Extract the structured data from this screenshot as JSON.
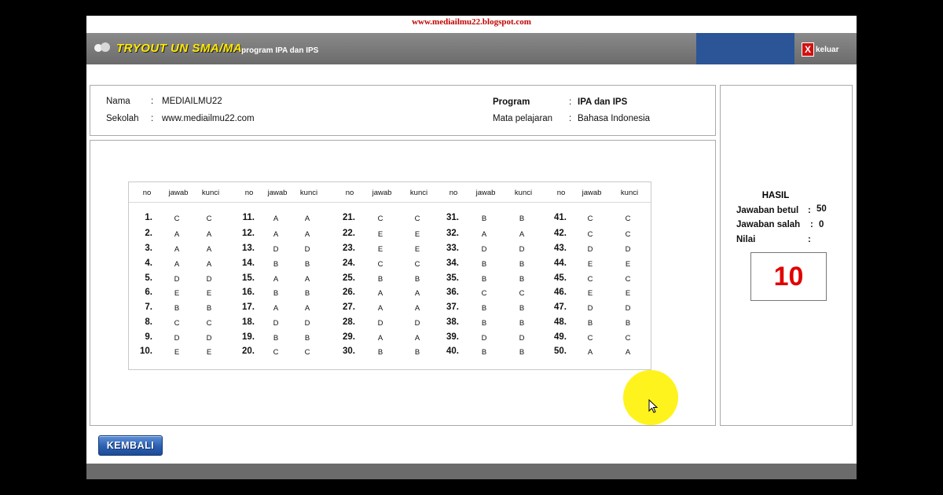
{
  "site_url": "www.mediailmu22.blogspot.com",
  "header": {
    "title": "TRYOUT UN SMA/MA",
    "subtitle": "program IPA dan IPS",
    "exit_icon_glyph": "X",
    "exit_label": "keluar",
    "exit_icon": "close-icon",
    "blue_accent": "#2b5597"
  },
  "info": {
    "nama_label": "Nama",
    "nama_value": "MEDIAILMU22",
    "sekolah_label": "Sekolah",
    "sekolah_value": "www.mediailmu22.com",
    "program_label": "Program",
    "program_value": "IPA dan IPS",
    "mapel_label": "Mata pelajaran",
    "mapel_value": "Bahasa Indonesia",
    "separator": ":"
  },
  "table": {
    "headers": [
      "no",
      "jawab",
      "kunci"
    ],
    "rows": [
      {
        "no": "1.",
        "jawab": "C",
        "kunci": "C"
      },
      {
        "no": "2.",
        "jawab": "A",
        "kunci": "A"
      },
      {
        "no": "3.",
        "jawab": "A",
        "kunci": "A"
      },
      {
        "no": "4.",
        "jawab": "A",
        "kunci": "A"
      },
      {
        "no": "5.",
        "jawab": "D",
        "kunci": "D"
      },
      {
        "no": "6.",
        "jawab": "E",
        "kunci": "E"
      },
      {
        "no": "7.",
        "jawab": "B",
        "kunci": "B"
      },
      {
        "no": "8.",
        "jawab": "C",
        "kunci": "C"
      },
      {
        "no": "9.",
        "jawab": "D",
        "kunci": "D"
      },
      {
        "no": "10.",
        "jawab": "E",
        "kunci": "E"
      },
      {
        "no": "11.",
        "jawab": "A",
        "kunci": "A"
      },
      {
        "no": "12.",
        "jawab": "A",
        "kunci": "A"
      },
      {
        "no": "13.",
        "jawab": "D",
        "kunci": "D"
      },
      {
        "no": "14.",
        "jawab": "B",
        "kunci": "B"
      },
      {
        "no": "15.",
        "jawab": "A",
        "kunci": "A"
      },
      {
        "no": "16.",
        "jawab": "B",
        "kunci": "B"
      },
      {
        "no": "17.",
        "jawab": "A",
        "kunci": "A"
      },
      {
        "no": "18.",
        "jawab": "D",
        "kunci": "D"
      },
      {
        "no": "19.",
        "jawab": "B",
        "kunci": "B"
      },
      {
        "no": "20.",
        "jawab": "C",
        "kunci": "C"
      },
      {
        "no": "21.",
        "jawab": "C",
        "kunci": "C"
      },
      {
        "no": "22.",
        "jawab": "E",
        "kunci": "E"
      },
      {
        "no": "23.",
        "jawab": "E",
        "kunci": "E"
      },
      {
        "no": "24.",
        "jawab": "C",
        "kunci": "C"
      },
      {
        "no": "25.",
        "jawab": "B",
        "kunci": "B"
      },
      {
        "no": "26.",
        "jawab": "A",
        "kunci": "A"
      },
      {
        "no": "27.",
        "jawab": "A",
        "kunci": "A"
      },
      {
        "no": "28.",
        "jawab": "D",
        "kunci": "D"
      },
      {
        "no": "29.",
        "jawab": "A",
        "kunci": "A"
      },
      {
        "no": "30.",
        "jawab": "B",
        "kunci": "B"
      },
      {
        "no": "31.",
        "jawab": "B",
        "kunci": "B"
      },
      {
        "no": "32.",
        "jawab": "A",
        "kunci": "A"
      },
      {
        "no": "33.",
        "jawab": "D",
        "kunci": "D"
      },
      {
        "no": "34.",
        "jawab": "B",
        "kunci": "B"
      },
      {
        "no": "35.",
        "jawab": "B",
        "kunci": "B"
      },
      {
        "no": "36.",
        "jawab": "C",
        "kunci": "C"
      },
      {
        "no": "37.",
        "jawab": "B",
        "kunci": "B"
      },
      {
        "no": "38.",
        "jawab": "B",
        "kunci": "B"
      },
      {
        "no": "39.",
        "jawab": "D",
        "kunci": "D"
      },
      {
        "no": "40.",
        "jawab": "B",
        "kunci": "B"
      },
      {
        "no": "41.",
        "jawab": "C",
        "kunci": "C"
      },
      {
        "no": "42.",
        "jawab": "C",
        "kunci": "C"
      },
      {
        "no": "43.",
        "jawab": "D",
        "kunci": "D"
      },
      {
        "no": "44.",
        "jawab": "E",
        "kunci": "E"
      },
      {
        "no": "45.",
        "jawab": "C",
        "kunci": "C"
      },
      {
        "no": "46.",
        "jawab": "E",
        "kunci": "E"
      },
      {
        "no": "47.",
        "jawab": "D",
        "kunci": "D"
      },
      {
        "no": "48.",
        "jawab": "B",
        "kunci": "B"
      },
      {
        "no": "49.",
        "jawab": "C",
        "kunci": "C"
      },
      {
        "no": "50.",
        "jawab": "A",
        "kunci": "A"
      }
    ]
  },
  "result": {
    "title": "HASIL",
    "betul_label": "Jawaban betul",
    "betul_value": "50",
    "salah_label": "Jawaban salah",
    "salah_value": "0",
    "nilai_label": "Nilai",
    "separator": ":",
    "score": "10",
    "score_color": "#e00000"
  },
  "footer": {
    "back_label": "KEMBALI"
  }
}
